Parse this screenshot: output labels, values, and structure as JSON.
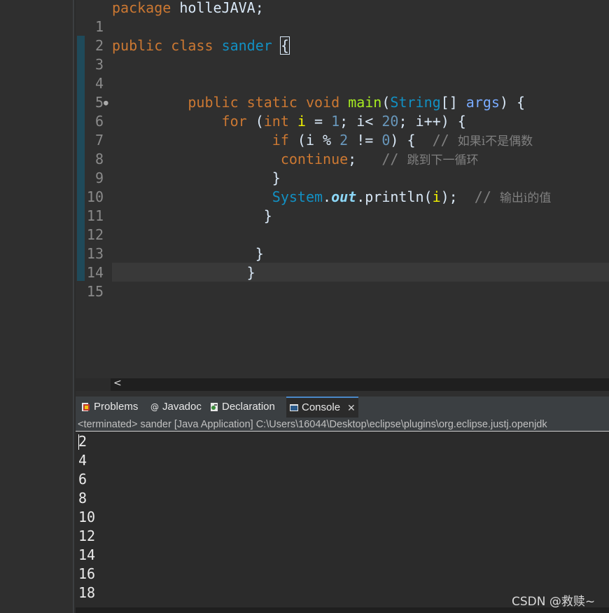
{
  "editor": {
    "line_numbers": [
      "1",
      "2",
      "3",
      "4",
      "5",
      "6",
      "7",
      "8",
      "9",
      "10",
      "11",
      "12",
      "13",
      "14",
      "15"
    ],
    "code": {
      "l1_kw": "package",
      "l1_rest": " holleJAVA;",
      "l3_kw1": "public",
      "l3_kw2": "class",
      "l3_cls": "sander",
      "l3_brace": "{",
      "l6_kw1": "public",
      "l6_kw2": "static",
      "l6_kw3": "void",
      "l6_fn": "main",
      "l6_type": "String",
      "l6_arr": "[] ",
      "l6_param": "args",
      "l6_end": ") {",
      "l7_kw": "for",
      "l7_int": "int",
      "l7_i": "i",
      "l7_eq": " = ",
      "l7_one": "1",
      "l7_semi": "; ",
      "l7_i2": "i",
      "l7_lt": "< ",
      "l7_twenty": "20",
      "l7_semi2": "; ",
      "l7_i3": "i",
      "l7_inc": "++) {",
      "l8_kw": "if",
      "l8_i": "i",
      "l8_mod": " % ",
      "l8_two": "2",
      "l8_ne": " != ",
      "l8_zero": "0",
      "l8_end": ") {  ",
      "l8_cmt": "// ",
      "l8_cmt_cn": "如果i不是偶数",
      "l9_kw": "continue",
      "l9_semi": ";   ",
      "l9_cmt": "// ",
      "l9_cmt_cn": "跳到下一循环",
      "l10": "}",
      "l11_cls": "System",
      "l11_dot": ".",
      "l11_field": "out",
      "l11_call": ".println(",
      "l11_i": "i",
      "l11_end": ");  ",
      "l11_cmt": "// ",
      "l11_cmt_cn": "输出i的值",
      "l12": "}",
      "l14": "}",
      "l15": "}"
    }
  },
  "panel": {
    "tabs": [
      {
        "label": "Problems",
        "icon": "problems-icon"
      },
      {
        "label": "Javadoc",
        "icon": "javadoc-icon"
      },
      {
        "label": "Declaration",
        "icon": "declaration-icon"
      },
      {
        "label": "Console",
        "icon": "console-icon",
        "active": true
      }
    ],
    "status": "<terminated> sander [Java Application] C:\\Users\\16044\\Desktop\\eclipse\\plugins\\org.eclipse.justj.openjdk"
  },
  "console_output": [
    "2",
    "4",
    "6",
    "8",
    "10",
    "12",
    "14",
    "16",
    "18"
  ],
  "watermark": "CSDN @救赎~"
}
